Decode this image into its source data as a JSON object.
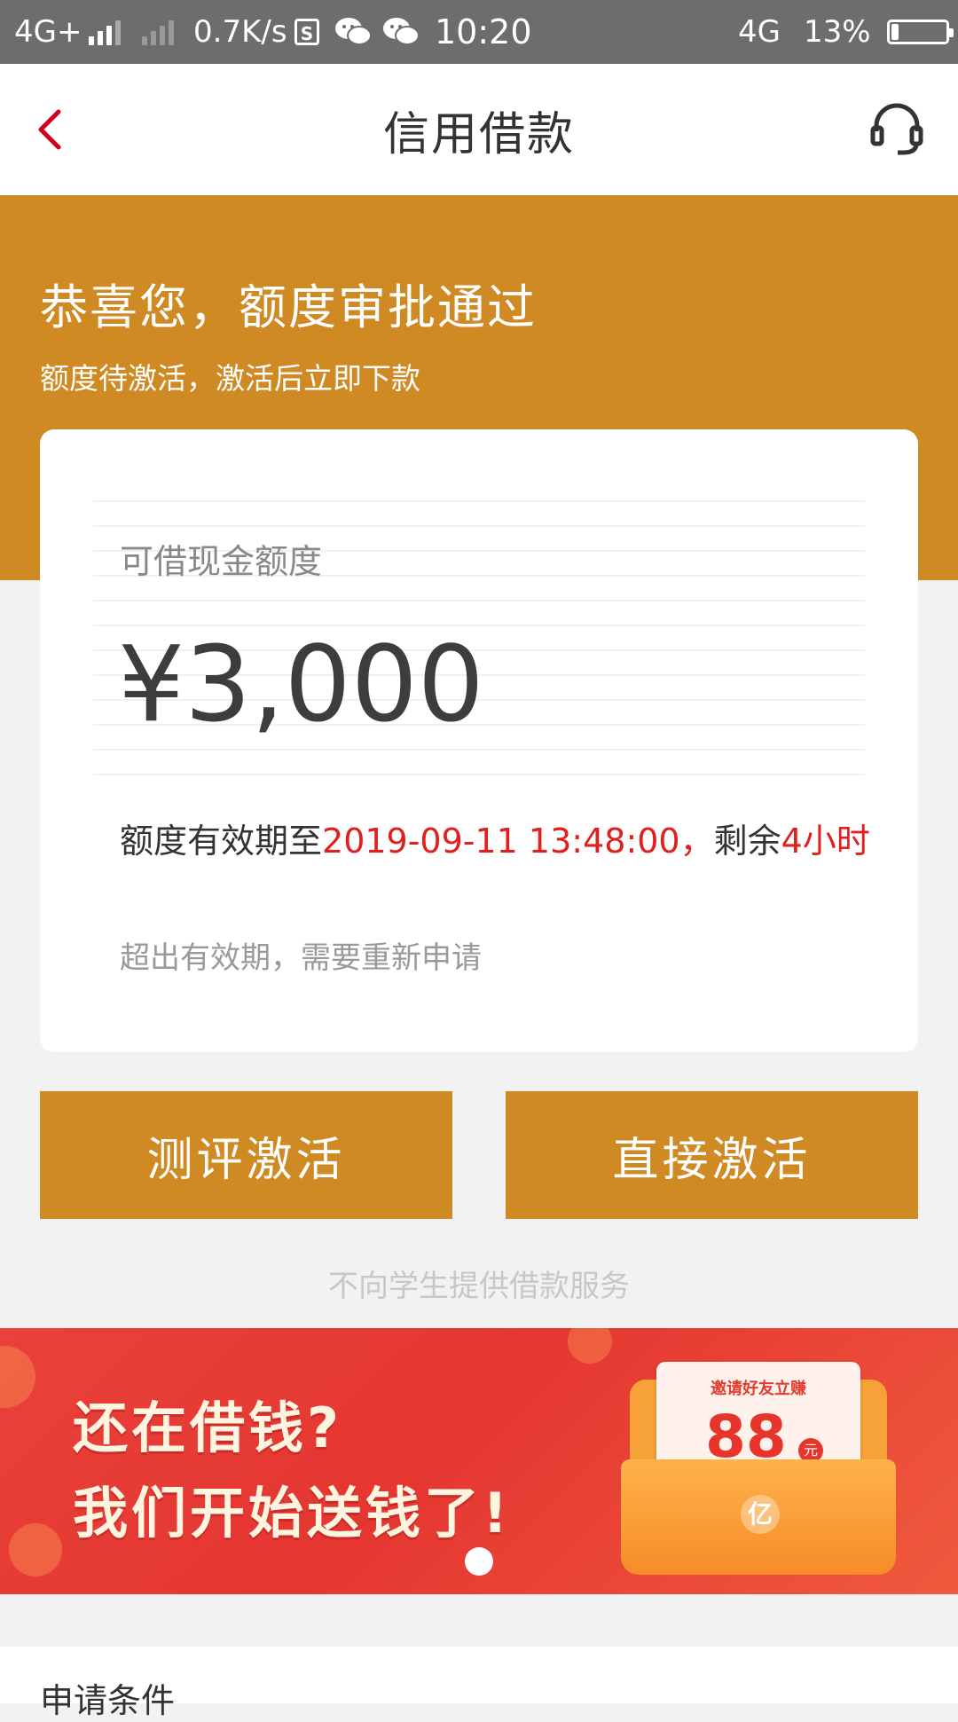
{
  "status_bar": {
    "network_left": "4G+",
    "speed": "0.7K/s",
    "time": "10:20",
    "network_right": "4G",
    "battery": "13%",
    "icons": [
      "signal-icon",
      "signal-weak-icon",
      "sim-box-icon",
      "wechat-icon",
      "wechat-icon",
      "battery-icon"
    ]
  },
  "nav": {
    "title": "信用借款",
    "back_icon": "back-chevron-icon",
    "service_icon": "headset-icon",
    "accent_color": "#d0021b"
  },
  "hero": {
    "headline": "恭喜您，额度审批通过",
    "subline": "额度待激活，激活后立即下款",
    "background_color": "#d08a23"
  },
  "card": {
    "quota_label": "可借现金额度",
    "quota_amount": "¥3,000",
    "validity_prefix": "额度有效期至",
    "validity_date": "2019-09-11 13:48:00，",
    "validity_remaining_prefix": "剩余",
    "validity_remaining": "4小时",
    "expire_note": "超出有效期，需要重新申请",
    "highlight_color": "#e0201f"
  },
  "actions": {
    "assess_label": "测评激活",
    "direct_label": "直接激活"
  },
  "student_note": "不向学生提供借款服务",
  "banner": {
    "line1": "还在借钱?",
    "line2": "我们开始送钱了!",
    "envelope_title": "邀请好友立赚",
    "envelope_amount": "88",
    "envelope_unit": "元",
    "envelope_logo": "亿"
  },
  "conditions": {
    "title": "申请条件"
  }
}
